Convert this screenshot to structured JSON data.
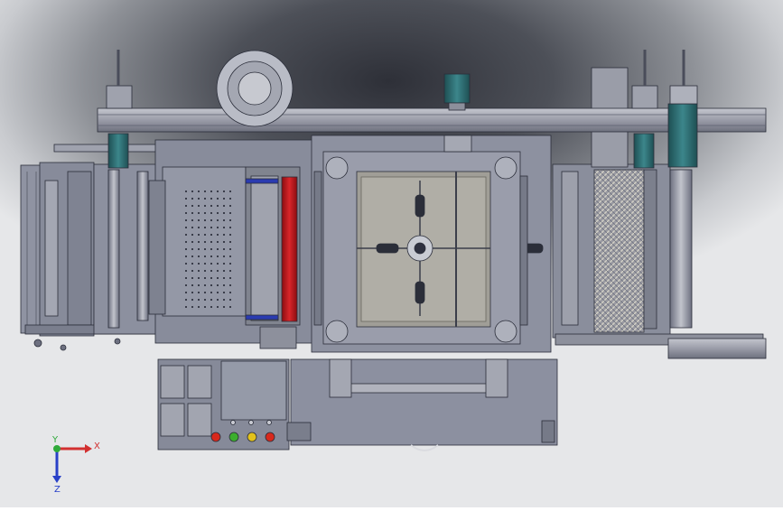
{
  "viewport": {
    "background_top": "#34363e",
    "background_bottom": "#e4e5e7",
    "part_color": "#8a8d9c",
    "rail_color": "#a7a9b4",
    "motor_color": "#2f6f74",
    "roller_color": "#c0171c"
  },
  "triad": {
    "x_label": "X",
    "y_label": "Y",
    "z_label": "Z",
    "x_color": "#d23030",
    "y_color": "#2faa3a",
    "z_color": "#2840c8"
  },
  "control_panel": {
    "indicator_colors": [
      "#d8281c",
      "#3cae2e",
      "#e3c21a",
      "#d8281c"
    ]
  }
}
